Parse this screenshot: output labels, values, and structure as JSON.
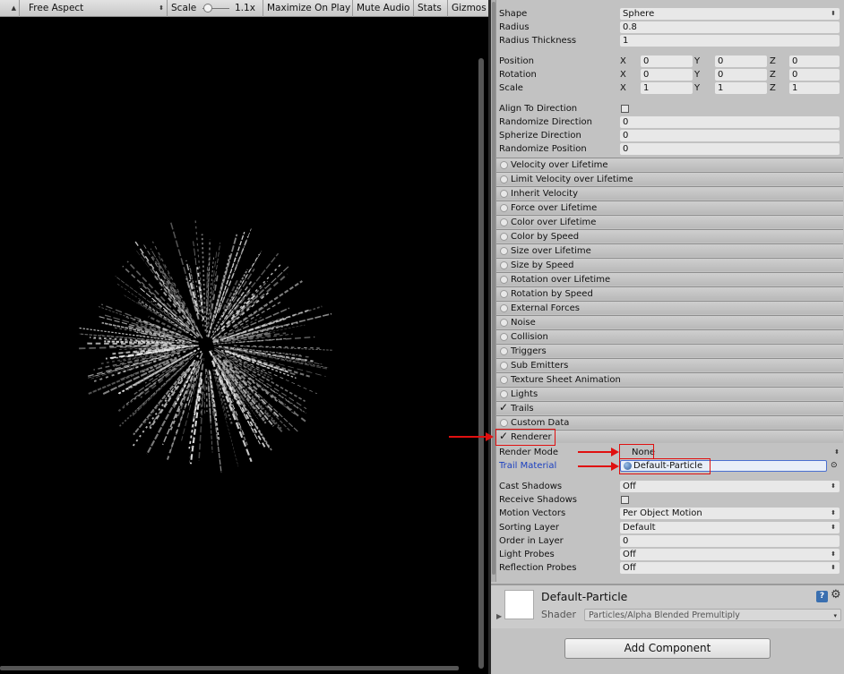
{
  "game_toolbar": {
    "aspect": "Free Aspect",
    "scale_label": "Scale",
    "scale_value": "1.1x",
    "maximize": "Maximize On Play",
    "mute": "Mute Audio",
    "stats": "Stats",
    "gizmos": "Gizmos"
  },
  "shape": {
    "shape_label": "Shape",
    "shape_value": "Sphere",
    "radius_label": "Radius",
    "radius_value": "0.8",
    "thickness_label": "Radius Thickness",
    "thickness_value": "1",
    "position_label": "Position",
    "position": [
      "0",
      "0",
      "0"
    ],
    "rotation_label": "Rotation",
    "rotation": [
      "0",
      "0",
      "0"
    ],
    "scale_label": "Scale",
    "scale": [
      "1",
      "1",
      "1"
    ],
    "axes": [
      "X",
      "Y",
      "Z"
    ],
    "align_label": "Align To Direction",
    "rand_dir_label": "Randomize Direction",
    "rand_dir_value": "0",
    "spher_dir_label": "Spherize Direction",
    "spher_dir_value": "0",
    "rand_pos_label": "Randomize Position",
    "rand_pos_value": "0"
  },
  "modules": [
    "Velocity over Lifetime",
    "Limit Velocity over Lifetime",
    "Inherit Velocity",
    "Force over Lifetime",
    "Color over Lifetime",
    "Color by Speed",
    "Size over Lifetime",
    "Size by Speed",
    "Rotation over Lifetime",
    "Rotation by Speed",
    "External Forces",
    "Noise",
    "Collision",
    "Triggers",
    "Sub Emitters",
    "Texture Sheet Animation",
    "Lights",
    "Trails",
    "Custom Data",
    "Renderer"
  ],
  "renderer": {
    "render_mode_label": "Render Mode",
    "render_mode_value": "None",
    "trail_material_label": "Trail Material",
    "trail_material_value": "Default-Particle",
    "cast_shadows_label": "Cast Shadows",
    "cast_shadows_value": "Off",
    "receive_shadows_label": "Receive Shadows",
    "motion_vectors_label": "Motion Vectors",
    "motion_vectors_value": "Per Object Motion",
    "sorting_layer_label": "Sorting Layer",
    "sorting_layer_value": "Default",
    "order_label": "Order in Layer",
    "order_value": "0",
    "light_probes_label": "Light Probes",
    "light_probes_value": "Off",
    "reflection_probes_label": "Reflection Probes",
    "reflection_probes_value": "Off"
  },
  "material": {
    "name": "Default-Particle",
    "shader_label": "Shader",
    "shader_value": "Particles/Alpha Blended Premultiply"
  },
  "add_component": "Add Component",
  "colors": {
    "accent_link": "#1a3fc0",
    "annotation": "#e01010"
  }
}
